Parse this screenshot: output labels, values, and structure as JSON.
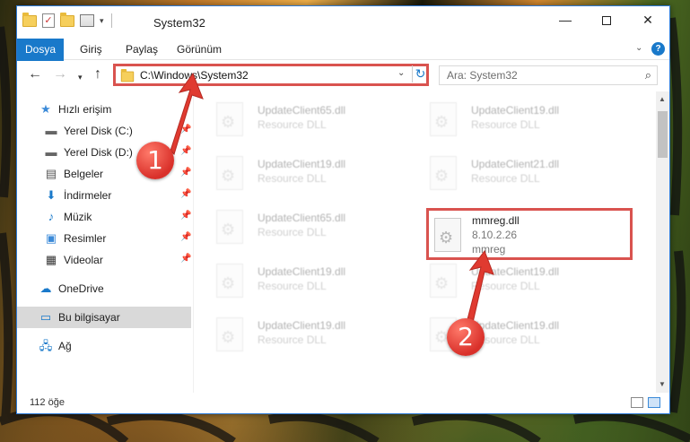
{
  "window": {
    "title": "System32",
    "controls": {
      "minimize": "—",
      "maximize": "",
      "close": "✕"
    }
  },
  "ribbon": {
    "tabs": [
      "Dosya",
      "Giriş",
      "Paylaş",
      "Görünüm"
    ],
    "help": "?"
  },
  "navigation": {
    "address": "C:\\Windows\\System32",
    "search_placeholder": "Ara: System32"
  },
  "sidebar": {
    "items": [
      {
        "label": "Hızlı erişim",
        "icon": "star-icon",
        "pinned": false
      },
      {
        "label": "Yerel Disk (C:)",
        "icon": "drive-icon",
        "pinned": true
      },
      {
        "label": "Yerel Disk (D:)",
        "icon": "drive-icon",
        "pinned": true
      },
      {
        "label": "Belgeler",
        "icon": "documents-icon",
        "pinned": true
      },
      {
        "label": "İndirmeler",
        "icon": "download-icon",
        "pinned": true
      },
      {
        "label": "Müzik",
        "icon": "music-icon",
        "pinned": true
      },
      {
        "label": "Resimler",
        "icon": "pictures-icon",
        "pinned": true
      },
      {
        "label": "Videolar",
        "icon": "video-icon",
        "pinned": true
      },
      {
        "label": "OneDrive",
        "icon": "cloud-icon",
        "pinned": false
      },
      {
        "label": "Bu bilgisayar",
        "icon": "computer-icon",
        "pinned": false,
        "selected": true
      },
      {
        "label": "Ağ",
        "icon": "network-icon",
        "pinned": false
      }
    ]
  },
  "files": [
    {
      "name": "UpdateClient65.dll",
      "desc": "Resource DLL"
    },
    {
      "name": "UpdateClient19.dll",
      "desc": "Resource DLL"
    },
    {
      "name": "UpdateClient19.dll",
      "desc": "Resource DLL"
    },
    {
      "name": "UpdateClient21.dll",
      "desc": "Resource DLL"
    },
    {
      "name": "UpdateClient65.dll",
      "desc": "Resource DLL"
    },
    {
      "name": "mmreg.dll",
      "version": "8.10.2.26",
      "desc": "mmreg"
    },
    {
      "name": "UpdateClient19.dll",
      "desc": "Resource DLL"
    },
    {
      "name": "UpdateClient19.dll",
      "desc": "Resource DLL"
    },
    {
      "name": "UpdateClient19.dll",
      "desc": "Resource DLL"
    },
    {
      "name": "UpdateClient19.dll",
      "desc": "Resource DLL"
    }
  ],
  "status": {
    "item_count": "112 öğe"
  },
  "annotations": {
    "step1": "1",
    "step2": "2"
  },
  "colors": {
    "accent": "#1979ca",
    "highlight": "#d9534f"
  }
}
